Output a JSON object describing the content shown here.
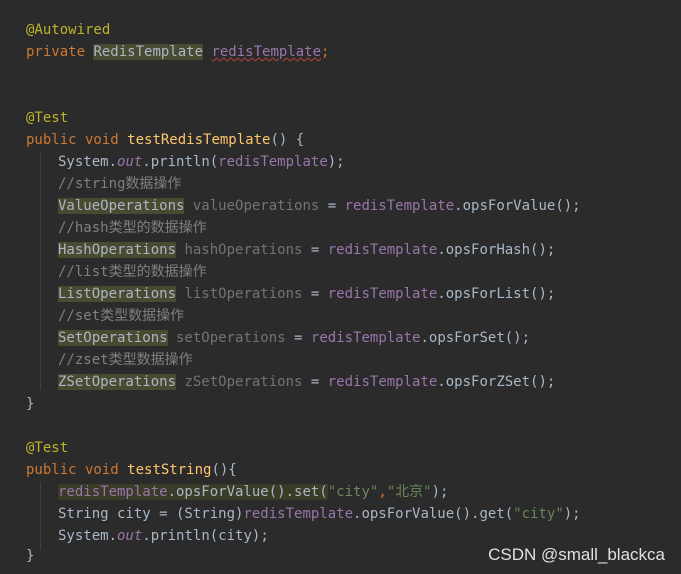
{
  "code": {
    "l1": {
      "ann": "@Autowired"
    },
    "l2": {
      "kw": "private ",
      "type": "RedisTemplate",
      "sp": " ",
      "field": "redisTemplate",
      "semi": ";"
    },
    "l3": {
      "ann": "@Test"
    },
    "l4": {
      "kw": "public void ",
      "fn": "testRedisTemplate",
      "rest": "() {"
    },
    "l5": {
      "a": "System.",
      "out": "out",
      "b": ".println(",
      "field": "redisTemplate",
      "c": ");"
    },
    "l6": {
      "cm": "//string数据操作"
    },
    "l7": {
      "type": "ValueOperations",
      "var": " valueOperations",
      "eq": " = ",
      "field": "redisTemplate",
      "call": ".opsForValue();"
    },
    "l8": {
      "cm": "//hash类型的数据操作"
    },
    "l9": {
      "type": "HashOperations",
      "var": " hashOperations",
      "eq": " = ",
      "field": "redisTemplate",
      "call": ".opsForHash();"
    },
    "l10": {
      "cm": "//list类型的数据操作"
    },
    "l11": {
      "type": "ListOperations",
      "var": " listOperations",
      "eq": " = ",
      "field": "redisTemplate",
      "call": ".opsForList();"
    },
    "l12": {
      "cm": "//set类型数据操作"
    },
    "l13": {
      "type": "SetOperations",
      "var": " setOperations",
      "eq": " = ",
      "field": "redisTemplate",
      "call": ".opsForSet();"
    },
    "l14": {
      "cm": "//zset类型数据操作"
    },
    "l15": {
      "type": "ZSetOperations",
      "var": " zSetOperations",
      "eq": " = ",
      "field": "redisTemplate",
      "call": ".opsForZSet();"
    },
    "l16": {
      "brace": "}"
    },
    "l17": {
      "ann": "@Test"
    },
    "l18": {
      "kw": "public void ",
      "fn": "testString",
      "rest": "(){"
    },
    "l19": {
      "field": "redisTemplate",
      "a": ".opsForValue().set(",
      "s1": "\"city\"",
      "comma": ",",
      "s2": "\"北京\"",
      "end": ");"
    },
    "l20": {
      "a": "String city = (String)",
      "field": "redisTemplate",
      "b": ".opsForValue().get(",
      "s1": "\"city\"",
      "end": ");"
    },
    "l21": {
      "a": "System.",
      "out": "out",
      "b": ".println(city);"
    },
    "l22": {
      "brace": "}"
    }
  },
  "watermark": "CSDN @small_blackca",
  "colors": {
    "background": "#2b2b2b",
    "annotation": "#bbb529",
    "keyword": "#cc7832",
    "method": "#ffc66d",
    "field": "#9876aa",
    "string": "#6a8759",
    "comment": "#808080",
    "text": "#a9b7c6"
  }
}
